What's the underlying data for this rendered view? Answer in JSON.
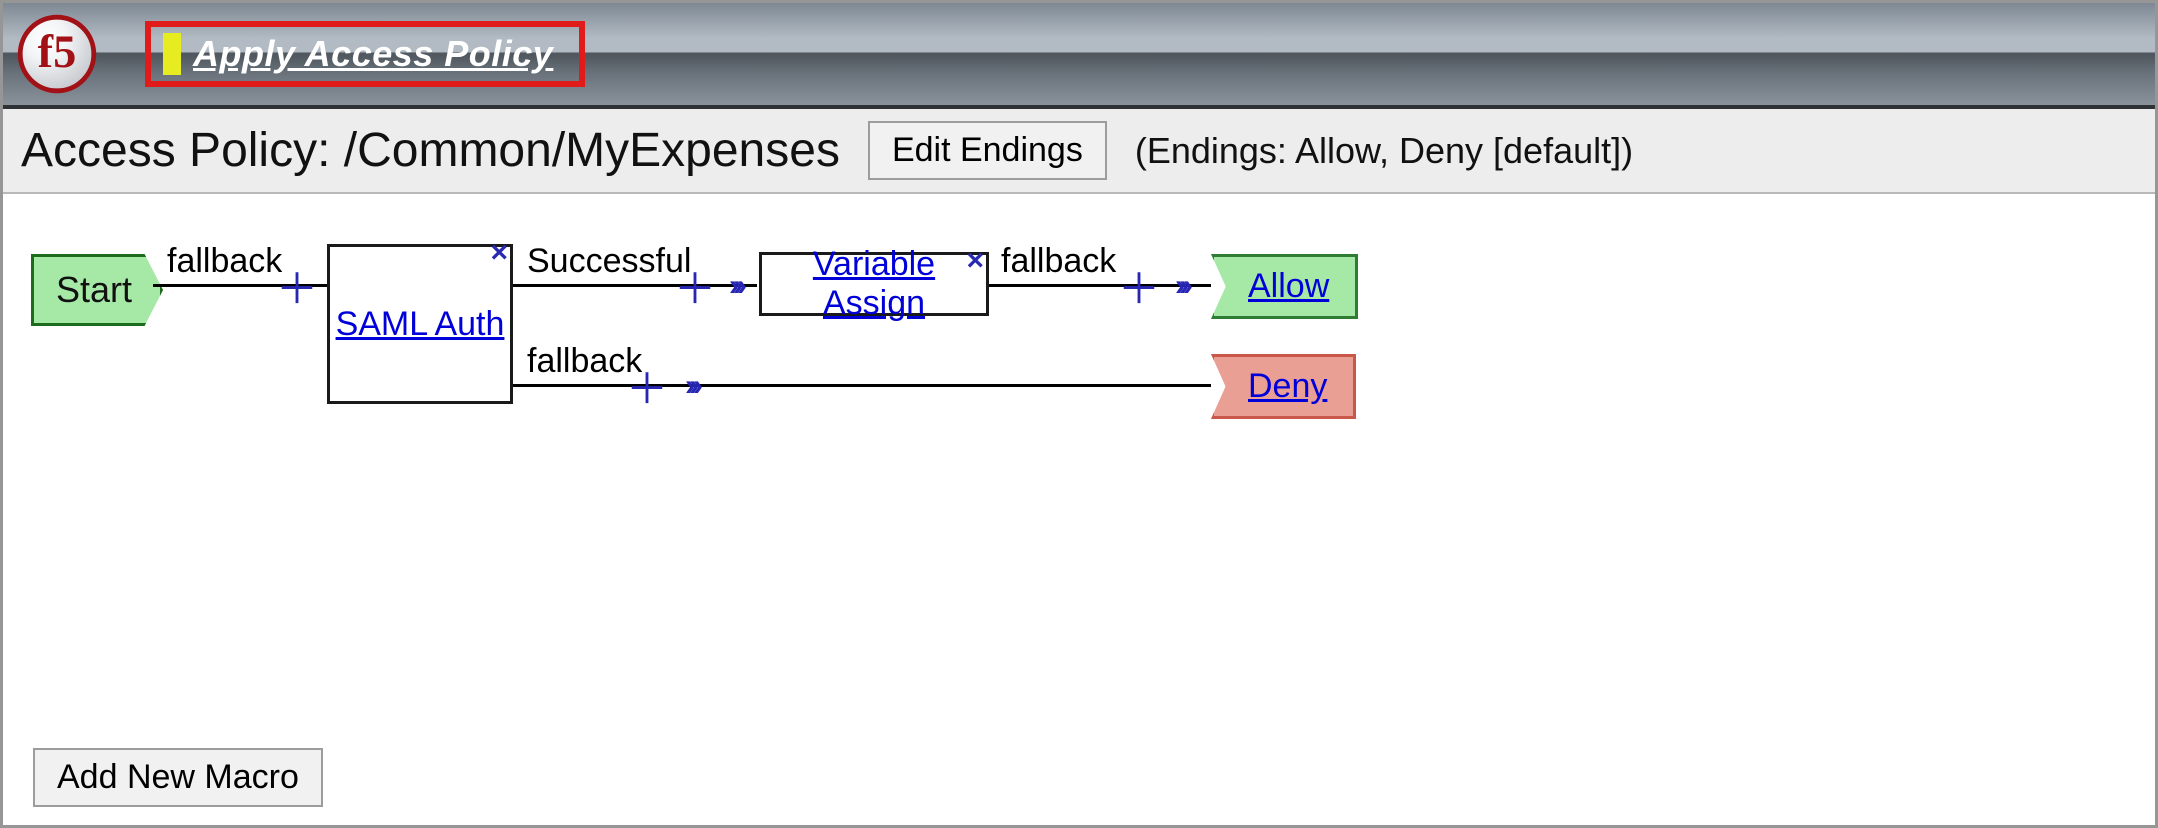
{
  "header": {
    "apply_label": "Apply Access Policy"
  },
  "title": {
    "prefix": "Access Policy: ",
    "path": "/Common/MyExpenses",
    "edit_endings_label": "Edit Endings",
    "endings_note": "(Endings: Allow, Deny [default])"
  },
  "flow": {
    "start_label": "Start",
    "edges": {
      "start_fallback": "fallback",
      "saml_successful": "Successful",
      "saml_fallback": "fallback",
      "var_fallback": "fallback"
    },
    "nodes": {
      "saml_auth": "SAML Auth",
      "variable_assign": "Variable Assign"
    },
    "endings": {
      "allow": "Allow",
      "deny": "Deny"
    }
  },
  "footer": {
    "add_macro_label": "Add New Macro"
  }
}
